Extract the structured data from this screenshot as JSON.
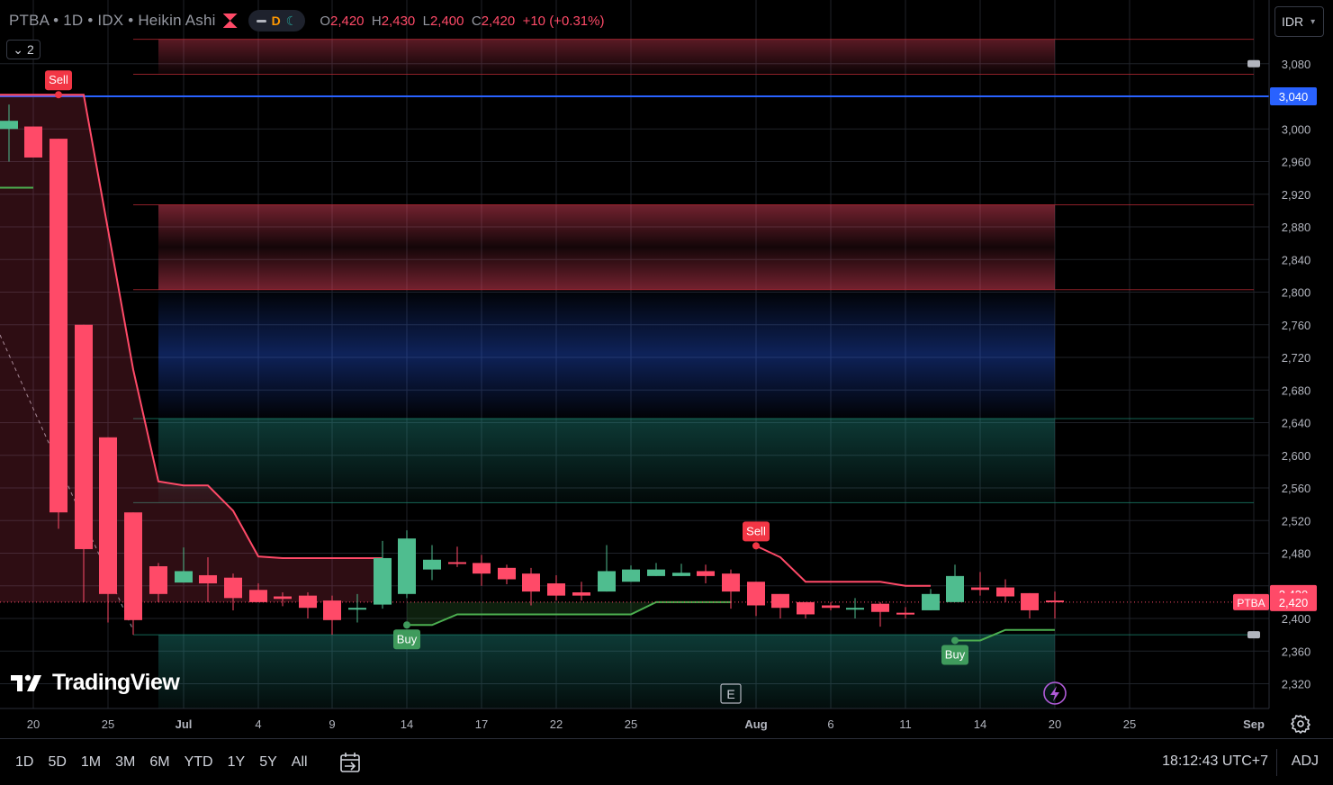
{
  "header": {
    "symbol_title": "PTBA • 1D • IDX • Heikin Ashi",
    "pill_d": "D",
    "ohlc": {
      "o_key": "O",
      "o": "2,420",
      "h_key": "H",
      "h": "2,430",
      "l_key": "L",
      "l": "2,400",
      "c_key": "C",
      "c": "2,420",
      "change": "+10 (+0.31%)"
    },
    "indicator_count": "2",
    "currency": "IDR"
  },
  "colors": {
    "up": "#4fbd8f",
    "down": "#ff4a68",
    "blue_line": "#2962ff",
    "trail_down": "#ff4a68",
    "trail_up": "#4caf50"
  },
  "chart_data": {
    "type": "candlestick",
    "style": "Heikin Ashi",
    "symbol": "PTBA",
    "interval": "1D",
    "exchange": "IDX",
    "ylim": [
      2280,
      3125
    ],
    "y_ticks": [
      "3,080",
      "3,000",
      "2,960",
      "2,920",
      "2,880",
      "2,840",
      "2,800",
      "2,760",
      "2,720",
      "2,680",
      "2,640",
      "2,600",
      "2,560",
      "2,520",
      "2,480",
      "2,400",
      "2,360",
      "2,320"
    ],
    "x_ticks": [
      "20",
      "25",
      "Jul",
      "4",
      "9",
      "14",
      "17",
      "22",
      "25",
      "Aug",
      "6",
      "11",
      "14",
      "20",
      "25",
      "Sep"
    ],
    "price_labels": [
      {
        "text": "3,040",
        "value": 3040,
        "color": "#2962ff"
      },
      {
        "text": "2,430",
        "value": 2430,
        "color": "#ff4a68"
      },
      {
        "text": "2,420",
        "value": 2420,
        "color": "#ff4a68"
      }
    ],
    "symbol_tag": "PTBA",
    "candles": [
      {
        "x": 10,
        "o": 3000,
        "h": 3030,
        "l": 2960,
        "c": 3010
      },
      {
        "x": 37,
        "o": 3003,
        "h": 3003,
        "l": 2965,
        "c": 2965
      },
      {
        "x": 65,
        "o": 2988,
        "h": 2988,
        "l": 2510,
        "c": 2530
      },
      {
        "x": 93,
        "o": 2760,
        "h": 2760,
        "l": 2420,
        "c": 2485
      },
      {
        "x": 120,
        "o": 2622,
        "h": 2622,
        "l": 2395,
        "c": 2430
      },
      {
        "x": 148,
        "o": 2530,
        "h": 2530,
        "l": 2380,
        "c": 2398
      },
      {
        "x": 176,
        "o": 2464,
        "h": 2468,
        "l": 2420,
        "c": 2430
      },
      {
        "x": 204,
        "o": 2444,
        "h": 2487,
        "l": 2444,
        "c": 2458
      },
      {
        "x": 231,
        "o": 2453,
        "h": 2475,
        "l": 2420,
        "c": 2443
      },
      {
        "x": 259,
        "o": 2450,
        "h": 2455,
        "l": 2410,
        "c": 2425
      },
      {
        "x": 287,
        "o": 2435,
        "h": 2443,
        "l": 2420,
        "c": 2420
      },
      {
        "x": 314,
        "o": 2427,
        "h": 2432,
        "l": 2415,
        "c": 2424
      },
      {
        "x": 342,
        "o": 2428,
        "h": 2432,
        "l": 2400,
        "c": 2413
      },
      {
        "x": 369,
        "o": 2422,
        "h": 2428,
        "l": 2380,
        "c": 2398
      },
      {
        "x": 397,
        "o": 2413,
        "h": 2430,
        "l": 2395,
        "c": 2413
      },
      {
        "x": 425,
        "o": 2417,
        "h": 2495,
        "l": 2412,
        "c": 2474
      },
      {
        "x": 452,
        "o": 2430,
        "h": 2508,
        "l": 2425,
        "c": 2498
      },
      {
        "x": 480,
        "o": 2460,
        "h": 2490,
        "l": 2447,
        "c": 2472
      },
      {
        "x": 508,
        "o": 2469,
        "h": 2488,
        "l": 2463,
        "c": 2467
      },
      {
        "x": 535,
        "o": 2468,
        "h": 2478,
        "l": 2440,
        "c": 2455
      },
      {
        "x": 563,
        "o": 2462,
        "h": 2466,
        "l": 2442,
        "c": 2448
      },
      {
        "x": 590,
        "o": 2455,
        "h": 2462,
        "l": 2416,
        "c": 2433
      },
      {
        "x": 618,
        "o": 2443,
        "h": 2453,
        "l": 2422,
        "c": 2428
      },
      {
        "x": 646,
        "o": 2432,
        "h": 2445,
        "l": 2422,
        "c": 2428
      },
      {
        "x": 674,
        "o": 2433,
        "h": 2490,
        "l": 2433,
        "c": 2458
      },
      {
        "x": 701,
        "o": 2445,
        "h": 2465,
        "l": 2445,
        "c": 2460
      },
      {
        "x": 729,
        "o": 2452,
        "h": 2468,
        "l": 2452,
        "c": 2460
      },
      {
        "x": 757,
        "o": 2452,
        "h": 2467,
        "l": 2452,
        "c": 2456
      },
      {
        "x": 784,
        "o": 2458,
        "h": 2466,
        "l": 2443,
        "c": 2452
      },
      {
        "x": 812,
        "o": 2455,
        "h": 2460,
        "l": 2412,
        "c": 2433
      },
      {
        "x": 840,
        "o": 2445,
        "h": 2445,
        "l": 2403,
        "c": 2416
      },
      {
        "x": 867,
        "o": 2430,
        "h": 2430,
        "l": 2400,
        "c": 2413
      },
      {
        "x": 895,
        "o": 2420,
        "h": 2420,
        "l": 2400,
        "c": 2405
      },
      {
        "x": 923,
        "o": 2416,
        "h": 2420,
        "l": 2410,
        "c": 2413
      },
      {
        "x": 950,
        "o": 2413,
        "h": 2425,
        "l": 2400,
        "c": 2413
      },
      {
        "x": 978,
        "o": 2418,
        "h": 2420,
        "l": 2390,
        "c": 2408
      },
      {
        "x": 1006,
        "o": 2407,
        "h": 2414,
        "l": 2400,
        "c": 2405
      },
      {
        "x": 1034,
        "o": 2410,
        "h": 2436,
        "l": 2410,
        "c": 2430
      },
      {
        "x": 1061,
        "o": 2420,
        "h": 2466,
        "l": 2420,
        "c": 2452
      },
      {
        "x": 1089,
        "o": 2438,
        "h": 2457,
        "l": 2428,
        "c": 2435
      },
      {
        "x": 1117,
        "o": 2438,
        "h": 2448,
        "l": 2420,
        "c": 2427
      },
      {
        "x": 1144,
        "o": 2431,
        "h": 2431,
        "l": 2400,
        "c": 2410
      },
      {
        "x": 1172,
        "o": 2422,
        "h": 2433,
        "l": 2400,
        "c": 2420
      }
    ],
    "trail_down": [
      [
        -10,
        3042
      ],
      [
        65,
        3042
      ],
      [
        93,
        3042
      ],
      [
        148,
        2705
      ],
      [
        176,
        2568
      ],
      [
        204,
        2563
      ],
      [
        231,
        2563
      ],
      [
        259,
        2532
      ],
      [
        287,
        2476
      ],
      [
        314,
        2474
      ],
      [
        342,
        2474
      ],
      [
        369,
        2474
      ],
      [
        397,
        2474
      ],
      [
        425,
        2474
      ]
    ],
    "trail_down_2": [
      [
        840,
        2489
      ],
      [
        867,
        2475
      ],
      [
        895,
        2445
      ],
      [
        923,
        2445
      ],
      [
        950,
        2445
      ],
      [
        978,
        2445
      ],
      [
        1006,
        2440
      ],
      [
        1034,
        2440
      ]
    ],
    "trail_up": [
      [
        -10,
        2928
      ],
      [
        37,
        2928
      ]
    ],
    "trail_up_2": [
      [
        452,
        2392
      ],
      [
        480,
        2392
      ],
      [
        508,
        2405
      ],
      [
        535,
        2405
      ],
      [
        563,
        2405
      ],
      [
        590,
        2405
      ],
      [
        618,
        2405
      ],
      [
        646,
        2405
      ],
      [
        674,
        2405
      ],
      [
        701,
        2405
      ],
      [
        729,
        2420
      ],
      [
        757,
        2420
      ],
      [
        784,
        2420
      ],
      [
        812,
        2420
      ]
    ],
    "trail_up_3": [
      [
        1061,
        2373
      ],
      [
        1089,
        2373
      ],
      [
        1117,
        2386
      ],
      [
        1144,
        2386
      ],
      [
        1172,
        2386
      ]
    ],
    "signals": [
      {
        "type": "sell",
        "label": "Sell",
        "x": 65,
        "value": 3042
      },
      {
        "type": "buy",
        "label": "Buy",
        "x": 452,
        "value": 2392
      },
      {
        "type": "sell",
        "label": "Sell",
        "x": 840,
        "value": 2489
      },
      {
        "type": "buy",
        "label": "Buy",
        "x": 1061,
        "value": 2373
      }
    ],
    "zones": [
      {
        "kind": "supply",
        "top": 3110,
        "bottom": 3067
      },
      {
        "kind": "supply",
        "top": 2907,
        "bottom": 2803
      },
      {
        "kind": "equilibrium",
        "top": 2803,
        "bottom": 2645
      },
      {
        "kind": "demand",
        "top": 2645,
        "bottom": 2542
      },
      {
        "kind": "demand",
        "top": 2380,
        "bottom": 2280
      }
    ],
    "blue_level": 3040,
    "current_level": 2420
  },
  "bottom_bar": {
    "ranges": [
      "1D",
      "5D",
      "1M",
      "3M",
      "6M",
      "YTD",
      "1Y",
      "5Y",
      "All"
    ],
    "clock": "18:12:43 UTC+7",
    "adj": "ADJ"
  },
  "logo_text": "TradingView",
  "marker_e": "E"
}
